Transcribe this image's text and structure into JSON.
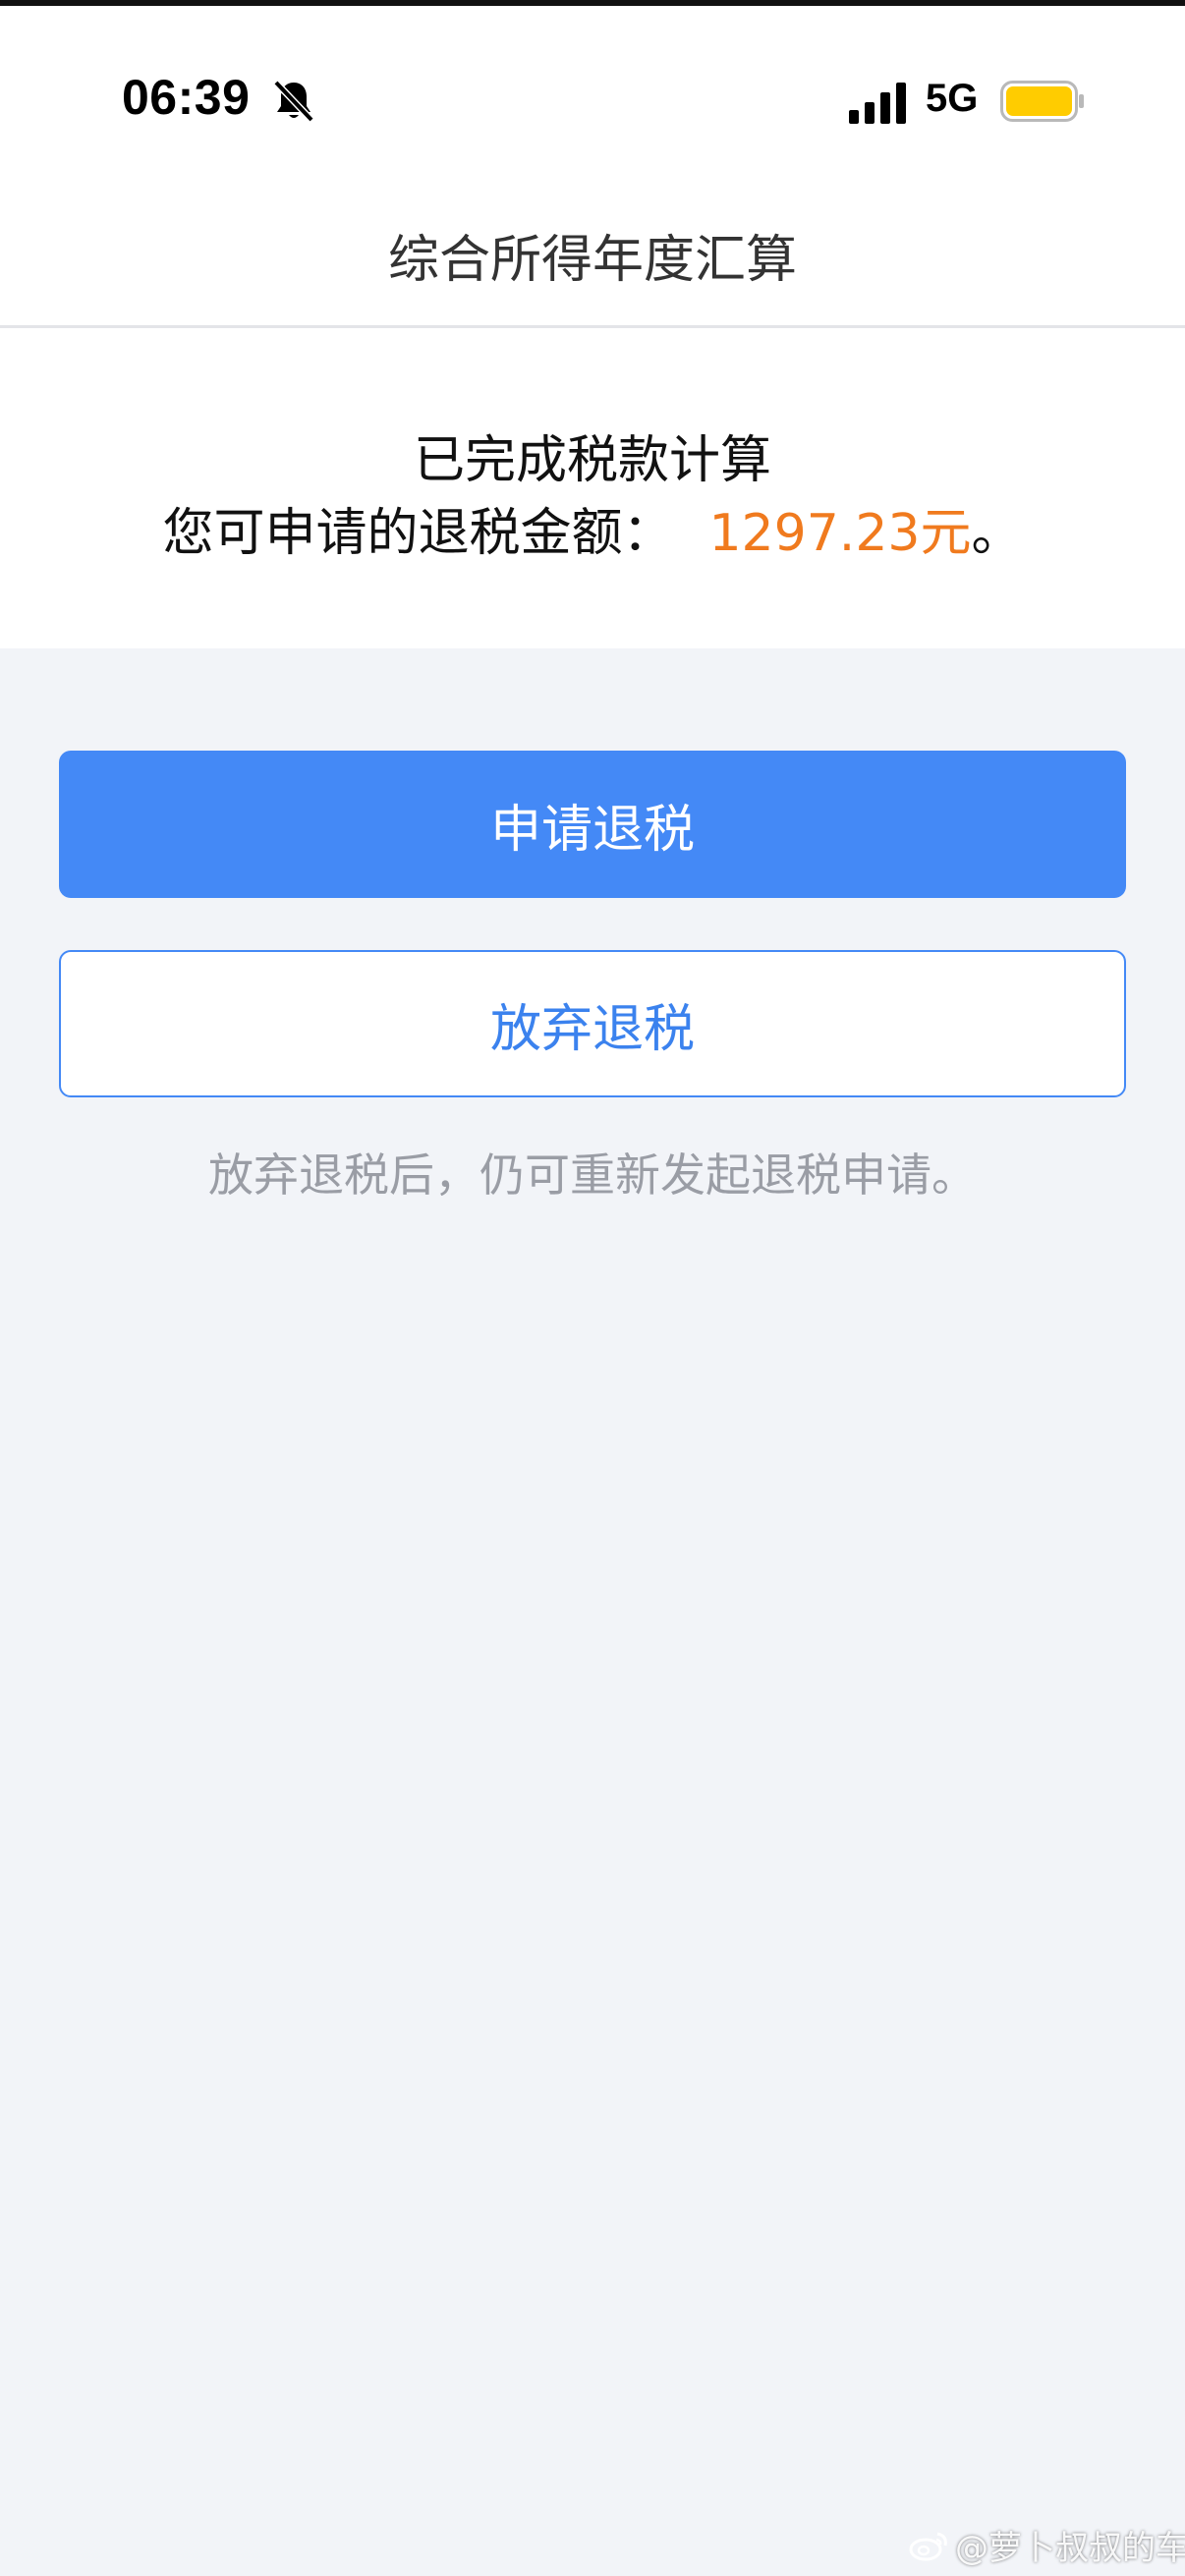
{
  "status_bar": {
    "time": "06:39",
    "network": "5G",
    "battery_color": "#ffcc00",
    "icons": [
      "bell-muted-icon",
      "signal-icon",
      "battery-icon"
    ]
  },
  "nav": {
    "title": "综合所得年度汇算"
  },
  "result": {
    "title": "已完成税款计算",
    "refund_label": "您可申请的退税金额：",
    "refund_amount": "1297.23元",
    "refund_suffix": "。",
    "amount_color": "#f07a1e"
  },
  "actions": {
    "apply_label": "申请退税",
    "abandon_label": "放弃退税",
    "hint": "放弃退税后，仍可重新发起退税申请。",
    "accent_color": "#4489f6"
  },
  "watermark": {
    "text": "@萝卜叔叔的车",
    "icon": "weibo-icon"
  }
}
